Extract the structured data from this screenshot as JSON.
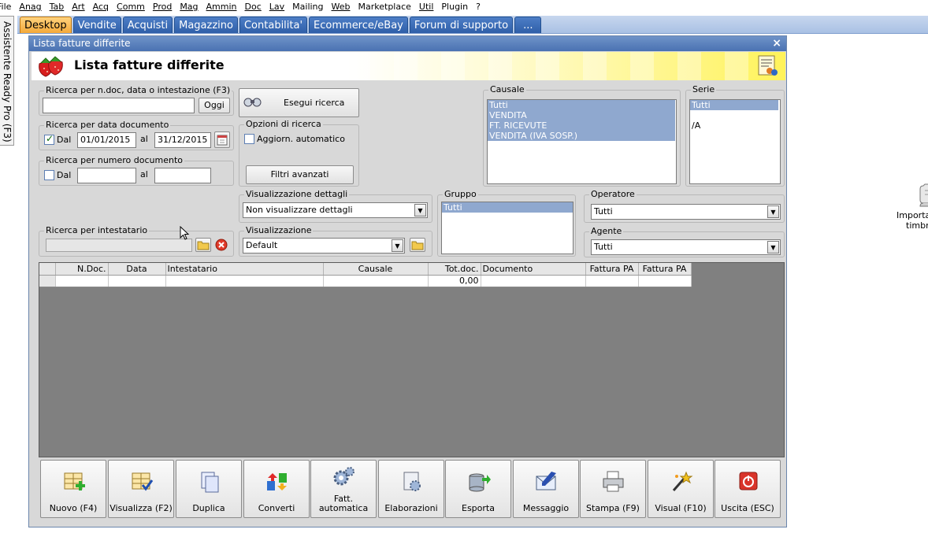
{
  "menu": [
    "File",
    "Anag",
    "Tab",
    "Art",
    "Acq",
    "Comm",
    "Prod",
    "Mag",
    "Ammin",
    "Doc",
    "Lav",
    "Mailing",
    "Web",
    "Marketplace",
    "Util",
    "Plugin",
    "?"
  ],
  "tabs": [
    {
      "label": "Desktop",
      "active": true
    },
    {
      "label": "Vendite"
    },
    {
      "label": "Acquisti"
    },
    {
      "label": "Magazzino"
    },
    {
      "label": "Contabilita'"
    },
    {
      "label": "Ecommerce/eBay"
    },
    {
      "label": "Forum di supporto"
    },
    {
      "label": "..."
    }
  ],
  "side_panel": {
    "label": "Assistente Ready Pro (F3)"
  },
  "desktop_icon": {
    "label_line1": "Importaz",
    "label_line2": "timbrat"
  },
  "window": {
    "title": "Lista fatture differite",
    "close_glyph": "×",
    "header_title": "Lista fatture differite"
  },
  "search_ndoc": {
    "legend": "Ricerca per n.doc, data o intestazione (F3)",
    "value": "",
    "oggi_label": "Oggi"
  },
  "search_date": {
    "legend": "Ricerca per data documento",
    "from_checked": true,
    "from_label": "Dal",
    "from_value": "01/01/2015",
    "to_label": "al",
    "to_value": "31/12/2015"
  },
  "search_number": {
    "legend": "Ricerca per numero documento",
    "from_checked": false,
    "from_label": "Dal",
    "from_value": "",
    "to_label": "al",
    "to_value": ""
  },
  "search_holder": {
    "legend": "Ricerca per intestatario",
    "value": ""
  },
  "search_button": {
    "label": "Esegui ricerca"
  },
  "search_options": {
    "legend": "Opzioni di ricerca",
    "auto_update_label": "Aggiorn. automatico",
    "auto_update_checked": false,
    "advanced_filters_label": "Filtri avanzati"
  },
  "details_view": {
    "legend": "Visualizzazione dettagli",
    "value": "Non visualizzare dettagli"
  },
  "view": {
    "legend": "Visualizzazione",
    "value": "Default"
  },
  "causale": {
    "legend": "Causale",
    "items": [
      {
        "label": "Tutti",
        "selected": true
      },
      {
        "label": "VENDITA",
        "selected": true
      },
      {
        "label": "FT. RICEVUTE",
        "selected": true
      },
      {
        "label": "VENDITA (IVA SOSP.)",
        "selected": true
      }
    ]
  },
  "serie": {
    "legend": "Serie",
    "items": [
      {
        "label": "Tutti",
        "selected": true
      },
      {
        "label": "",
        "selected": false
      },
      {
        "label": "/A",
        "selected": false
      }
    ]
  },
  "gruppo": {
    "legend": "Gruppo",
    "items": [
      {
        "label": "Tutti",
        "selected": true
      }
    ]
  },
  "operatore": {
    "legend": "Operatore",
    "value": "Tutti"
  },
  "agente": {
    "legend": "Agente",
    "value": "Tutti"
  },
  "grid": {
    "columns": [
      "N.Doc.",
      "Data",
      "Intestatario",
      "Causale",
      "Tot.doc.",
      "Documento",
      "Fattura PA",
      "Fattura PA"
    ],
    "rows": [
      [
        "",
        "",
        "",
        "",
        "0,00",
        "",
        "",
        ""
      ]
    ]
  },
  "toolbar": [
    {
      "label": "Nuovo (F4)",
      "icon": "new-document-icon"
    },
    {
      "label": "Visualizza (F2)",
      "icon": "view-document-icon"
    },
    {
      "label": "Duplica",
      "icon": "duplicate-icon"
    },
    {
      "label": "Converti",
      "icon": "convert-icon"
    },
    {
      "label": "Fatt.",
      "label2": "automatica",
      "icon": "gears-icon"
    },
    {
      "label": "Elaborazioni",
      "icon": "processing-icon"
    },
    {
      "label": "Esporta",
      "icon": "export-icon"
    },
    {
      "label": "Messaggio",
      "icon": "message-icon"
    },
    {
      "label": "Stampa (F9)",
      "icon": "printer-icon"
    },
    {
      "label": "Visual (F10)",
      "icon": "magic-wand-icon"
    },
    {
      "label": "Uscita (ESC)",
      "icon": "exit-icon"
    }
  ]
}
